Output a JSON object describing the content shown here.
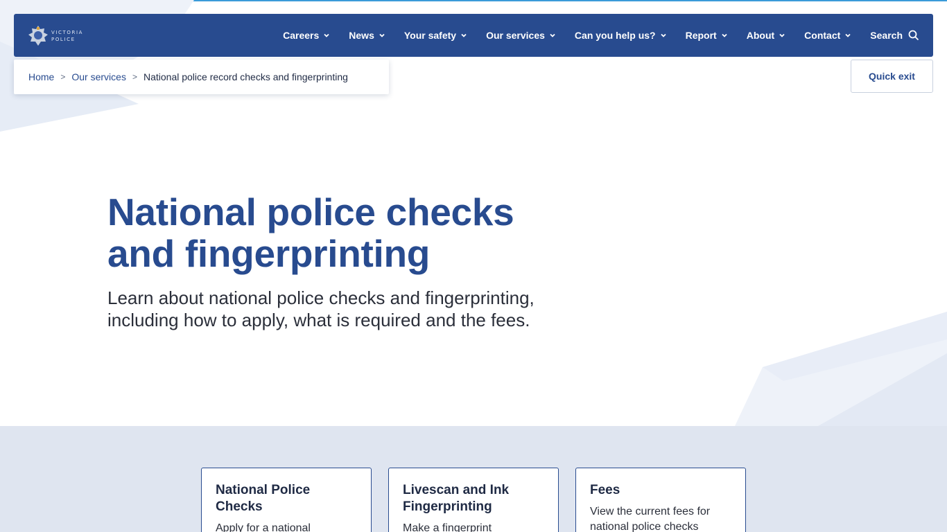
{
  "site": {
    "logo_line1": "VICTORIA",
    "logo_line2": "POLICE"
  },
  "nav": {
    "items": [
      {
        "label": "Careers"
      },
      {
        "label": "News"
      },
      {
        "label": "Your safety"
      },
      {
        "label": "Our services"
      },
      {
        "label": "Can you help us?"
      },
      {
        "label": "Report"
      },
      {
        "label": "About"
      },
      {
        "label": "Contact"
      }
    ],
    "search_label": "Search"
  },
  "breadcrumb": {
    "home": "Home",
    "parent": "Our services",
    "current": "National police record checks and fingerprinting",
    "separator": ">"
  },
  "quick_exit_label": "Quick exit",
  "hero": {
    "title_line1": "National police checks",
    "title_line2": "and fingerprinting",
    "intro": "Learn about national police checks and fingerprinting, including how to apply, what is required and the fees."
  },
  "cards": [
    {
      "title": "National Police Checks",
      "description": "Apply for a national"
    },
    {
      "title": "Livescan and Ink Fingerprinting",
      "description": "Make a fingerprint"
    },
    {
      "title": "Fees",
      "description": "View the current fees for national police checks"
    }
  ],
  "colors": {
    "brand_navy": "#284b8f",
    "band_bg": "#dfe5f0",
    "top_line": "#3a9bd9"
  }
}
